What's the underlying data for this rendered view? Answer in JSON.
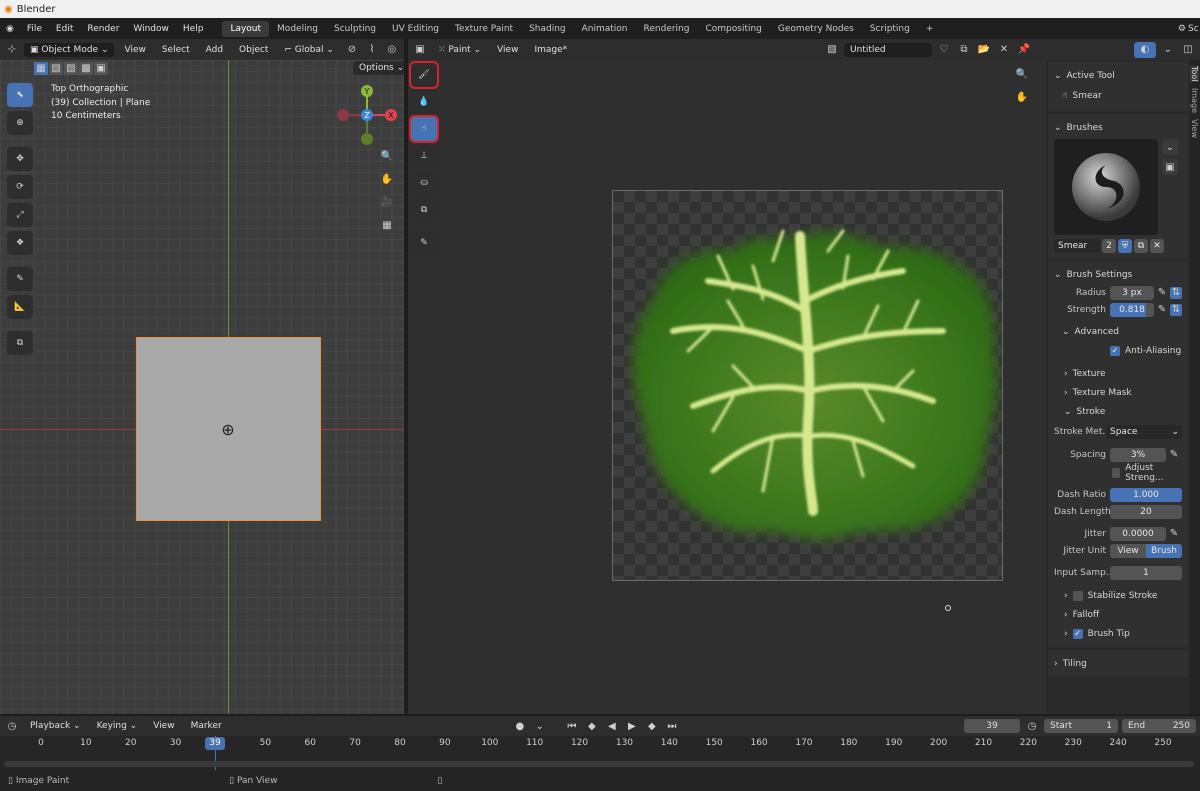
{
  "app": {
    "title": "Blender"
  },
  "menu": {
    "items": [
      "File",
      "Edit",
      "Render",
      "Window",
      "Help"
    ]
  },
  "workspaces": [
    {
      "label": "Layout",
      "active": true
    },
    {
      "label": "Modeling"
    },
    {
      "label": "Sculpting"
    },
    {
      "label": "UV Editing"
    },
    {
      "label": "Texture Paint"
    },
    {
      "label": "Shading"
    },
    {
      "label": "Animation"
    },
    {
      "label": "Rendering"
    },
    {
      "label": "Compositing"
    },
    {
      "label": "Geometry Nodes"
    },
    {
      "label": "Scripting"
    }
  ],
  "workspace_add": "+",
  "scene_name": "Sc",
  "viewport": {
    "mode": "Object Mode",
    "menus": [
      "View",
      "Select",
      "Add",
      "Object"
    ],
    "transform": "Global",
    "options": "Options",
    "overlay_lines": [
      "Top Orthographic",
      "(39) Collection | Plane",
      "10 Centimeters"
    ],
    "gizmo": {
      "y": "Y",
      "z": "Z",
      "x": "X"
    }
  },
  "image_editor": {
    "mode": "Paint",
    "menus": [
      "View",
      "Image*"
    ],
    "image_name": "Untitled"
  },
  "sidebar": {
    "tabs": [
      "Tool",
      "Image",
      "View"
    ],
    "active_tool": {
      "header": "Active Tool",
      "name": "Smear"
    },
    "brushes": {
      "header": "Brushes",
      "name": "Smear",
      "users": "2"
    },
    "brush_settings": {
      "header": "Brush Settings",
      "radius_label": "Radius",
      "radius": "3 px",
      "strength_label": "Strength",
      "strength": "0.818",
      "strength_fill": 0.818,
      "advanced": "Advanced",
      "anti_aliasing": "Anti-Aliasing",
      "texture": "Texture",
      "texture_mask": "Texture Mask",
      "stroke": "Stroke",
      "stroke_method_label": "Stroke Met...",
      "stroke_method": "Space",
      "spacing_label": "Spacing",
      "spacing": "3%",
      "adjust_strength": "Adjust Streng...",
      "dash_ratio_label": "Dash Ratio",
      "dash_ratio": "1.000",
      "dash_length_label": "Dash Length",
      "dash_length": "20",
      "jitter_label": "Jitter",
      "jitter": "0.0000",
      "jitter_unit_label": "Jitter Unit",
      "jitter_unit_view": "View",
      "jitter_unit_brush": "Brush",
      "input_samples_label": "Input Samp...",
      "input_samples": "1",
      "stabilize_stroke": "Stabilize Stroke",
      "falloff": "Falloff",
      "brush_tip": "Brush Tip",
      "tiling": "Tiling"
    }
  },
  "timeline": {
    "menus": [
      "Playback",
      "Keying",
      "View",
      "Marker"
    ],
    "current_frame": "39",
    "start_label": "Start",
    "start": "1",
    "end_label": "End",
    "end": "250",
    "ticks": [
      "0",
      "10",
      "20",
      "30",
      "39",
      "50",
      "60",
      "70",
      "80",
      "90",
      "100",
      "110",
      "120",
      "130",
      "140",
      "150",
      "160",
      "170",
      "180",
      "190",
      "200",
      "210",
      "220",
      "230",
      "240",
      "250"
    ]
  },
  "status": {
    "left": "Image Paint",
    "middle": "Pan View"
  }
}
